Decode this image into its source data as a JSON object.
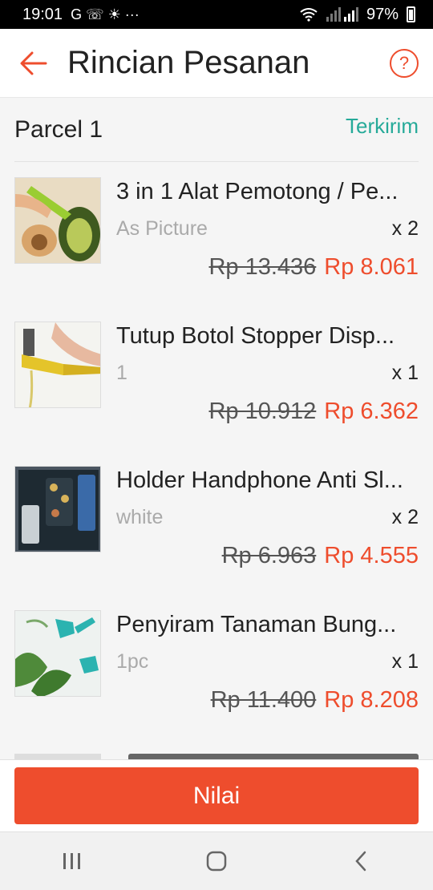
{
  "status_bar": {
    "time": "19:01",
    "notification_icons": "G ☏ ☀ ···",
    "battery": "97%"
  },
  "header": {
    "title": "Rincian Pesanan"
  },
  "parcel": {
    "title": "Parcel 1",
    "status": "Terkirim"
  },
  "items": [
    {
      "name": "3 in 1 Alat Pemotong / Pe...",
      "variant": "As Picture",
      "qty": "x 2",
      "old_price": "Rp 13.436",
      "price": "Rp 8.061"
    },
    {
      "name": "Tutup Botol Stopper Disp...",
      "variant": "1",
      "qty": "x 1",
      "old_price": "Rp 10.912",
      "price": "Rp 6.362"
    },
    {
      "name": "Holder Handphone Anti Sl...",
      "variant": "white",
      "qty": "x 2",
      "old_price": "Rp 6.963",
      "price": "Rp 4.555"
    },
    {
      "name": "Penyiram Tanaman Bung...",
      "variant": "1pc",
      "qty": "x 1",
      "old_price": "Rp 11.400",
      "price": "Rp 8.208"
    }
  ],
  "action": {
    "label": "Nilai"
  },
  "colors": {
    "brand": "#ee4d2d",
    "status": "#26aa99"
  },
  "icons": {
    "back": "arrow-left-icon",
    "help": "question-circle-icon"
  }
}
